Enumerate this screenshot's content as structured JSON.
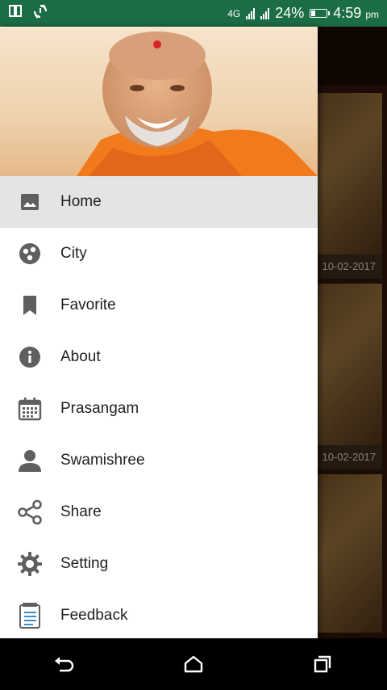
{
  "status_bar": {
    "network": "4G",
    "battery_percent": "24%",
    "time": "4:59",
    "time_suffix": "pm",
    "battery_level": 0.24
  },
  "background_cards": [
    {
      "date": "10-02-2017"
    },
    {
      "date": "10-02-2017"
    },
    {
      "date": ""
    }
  ],
  "drawer": {
    "menu": [
      {
        "label": "Home",
        "icon": "image-icon",
        "active": true
      },
      {
        "label": "City",
        "icon": "city-icon"
      },
      {
        "label": "Favorite",
        "icon": "bookmark-icon"
      },
      {
        "label": "About",
        "icon": "info-icon"
      },
      {
        "label": "Prasangam",
        "icon": "calendar-icon"
      },
      {
        "label": "Swamishree",
        "icon": "person-icon"
      },
      {
        "label": "Share",
        "icon": "share-icon"
      },
      {
        "label": "Setting",
        "icon": "gear-icon"
      },
      {
        "label": "Feedback",
        "icon": "feedback-icon"
      }
    ]
  },
  "colors": {
    "status_bar": "#1b6d45",
    "icon": "#5f5f5f",
    "active_item": "#e4e4e4"
  }
}
